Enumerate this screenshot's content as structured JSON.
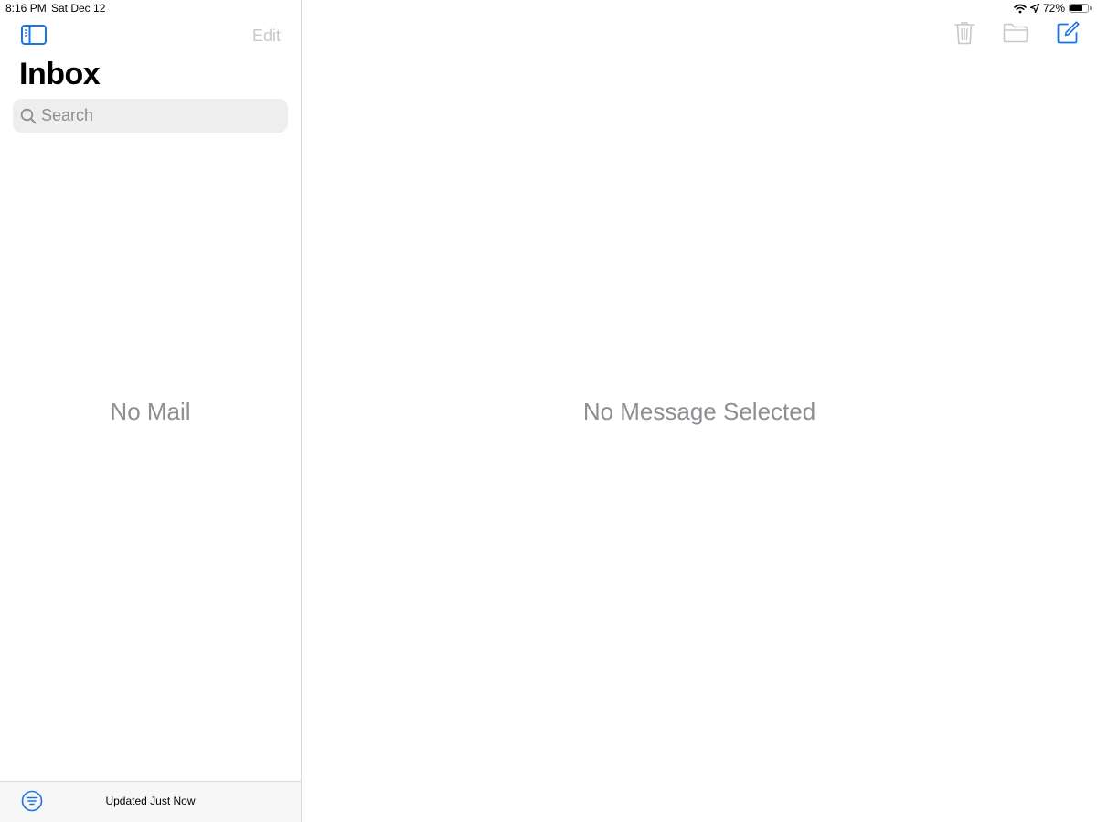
{
  "status_bar": {
    "time": "8:16 PM",
    "date": "Sat Dec 12",
    "battery_percent": "72%",
    "battery_level": 0.72,
    "icons": [
      "wifi-icon",
      "location-arrow-icon",
      "battery-icon"
    ]
  },
  "sidebar": {
    "toggle_icon": "sidebar-toggle-icon",
    "edit_label": "Edit",
    "title": "Inbox",
    "search": {
      "placeholder": "Search",
      "value": ""
    },
    "empty_text": "No Mail",
    "bottom_bar": {
      "filter_icon": "filter-icon",
      "status": "Updated Just Now"
    }
  },
  "detail": {
    "toolbar": [
      "trash-icon",
      "folder-icon",
      "compose-icon"
    ],
    "empty_text": "No Message Selected"
  },
  "colors": {
    "accent": "#1a73e8",
    "disabled": "#c7c7cc",
    "placeholder_gray": "#8e8e93",
    "search_bg": "#eeeeef"
  }
}
